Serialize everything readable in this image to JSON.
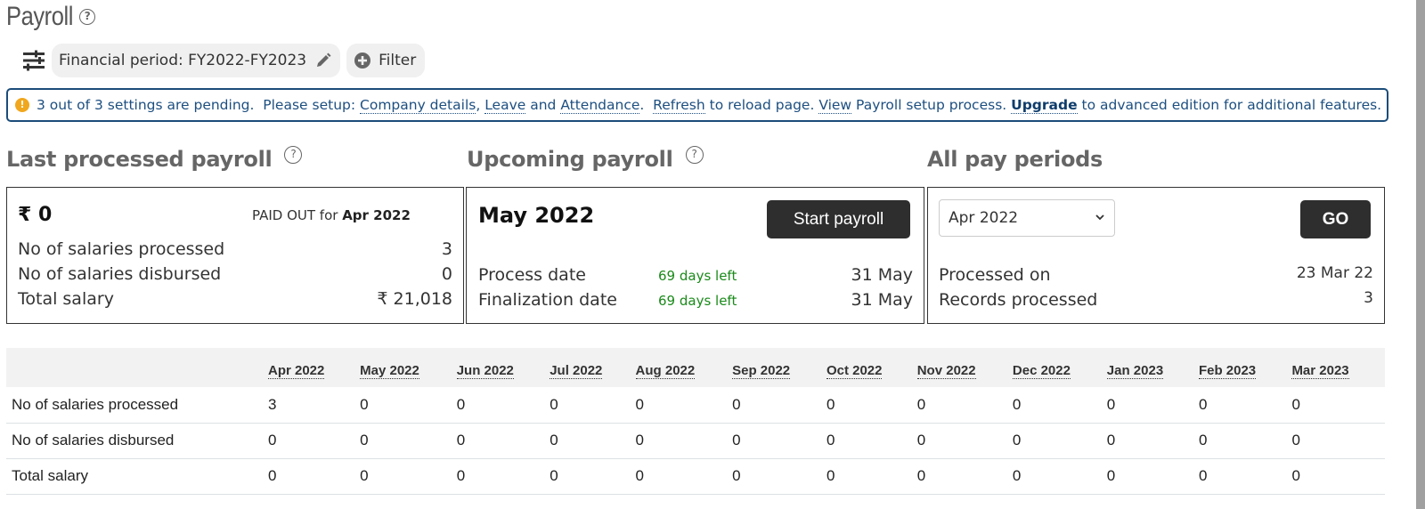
{
  "header": {
    "title": "Payroll",
    "help_glyph": "?"
  },
  "filters": {
    "financial_period_label": "Financial period: FY2022-FY2023",
    "filter_label": "Filter"
  },
  "alert": {
    "icon_glyph": "!",
    "text_1": "3 out of 3 settings are pending.  Please setup: ",
    "link_company": "Company details",
    "sep_1": ", ",
    "link_leave": "Leave",
    "sep_2": " and ",
    "link_attendance": "Attendance",
    "sep_3": ".  ",
    "link_refresh": "Refresh",
    "text_2": " to reload page. ",
    "link_view": "View",
    "text_3": " Payroll setup process. ",
    "link_upgrade": "Upgrade",
    "text_4": " to advanced edition for additional features."
  },
  "last_processed": {
    "title": "Last processed payroll",
    "amount": "₹ 0",
    "paid_out_prefix": "PAID OUT for ",
    "paid_out_month": "Apr 2022",
    "rows": [
      {
        "label": "No of salaries processed",
        "value": "3"
      },
      {
        "label": "No of salaries disbursed",
        "value": "0"
      },
      {
        "label": "Total salary",
        "value": "₹ 21,018"
      }
    ]
  },
  "upcoming": {
    "title": "Upcoming payroll",
    "month": "May 2022",
    "start_button": "Start payroll",
    "rows": [
      {
        "label": "Process date",
        "days_left": "69 days left",
        "value": "31 May"
      },
      {
        "label": "Finalization date",
        "days_left": "69 days left",
        "value": "31 May"
      }
    ]
  },
  "all_periods": {
    "title": "All pay periods",
    "selected_period": "Apr 2022",
    "go_button": "GO",
    "rows": [
      {
        "label": "Processed on",
        "value": "23 Mar 22"
      },
      {
        "label": "Records processed",
        "value": "3"
      }
    ]
  },
  "table": {
    "columns": [
      "Apr 2022",
      "May 2022",
      "Jun 2022",
      "Jul 2022",
      "Aug 2022",
      "Sep 2022",
      "Oct 2022",
      "Nov 2022",
      "Dec 2022",
      "Jan 2023",
      "Feb 2023",
      "Mar 2023"
    ],
    "rows": [
      {
        "label": "No of salaries processed",
        "values": [
          "3",
          "0",
          "0",
          "0",
          "0",
          "0",
          "0",
          "0",
          "0",
          "0",
          "0",
          "0"
        ]
      },
      {
        "label": "No of salaries disbursed",
        "values": [
          "0",
          "0",
          "0",
          "0",
          "0",
          "0",
          "0",
          "0",
          "0",
          "0",
          "0",
          "0"
        ]
      },
      {
        "label": "Total salary",
        "values": [
          "0",
          "0",
          "0",
          "0",
          "0",
          "0",
          "0",
          "0",
          "0",
          "0",
          "0",
          "0"
        ]
      }
    ]
  },
  "colors": {
    "alert_border": "#1b4c7a",
    "alert_text": "#1d4f80",
    "warning": "#f0a71e",
    "days_left": "#1a8a1a",
    "dark_button": "#2e2e2e"
  }
}
